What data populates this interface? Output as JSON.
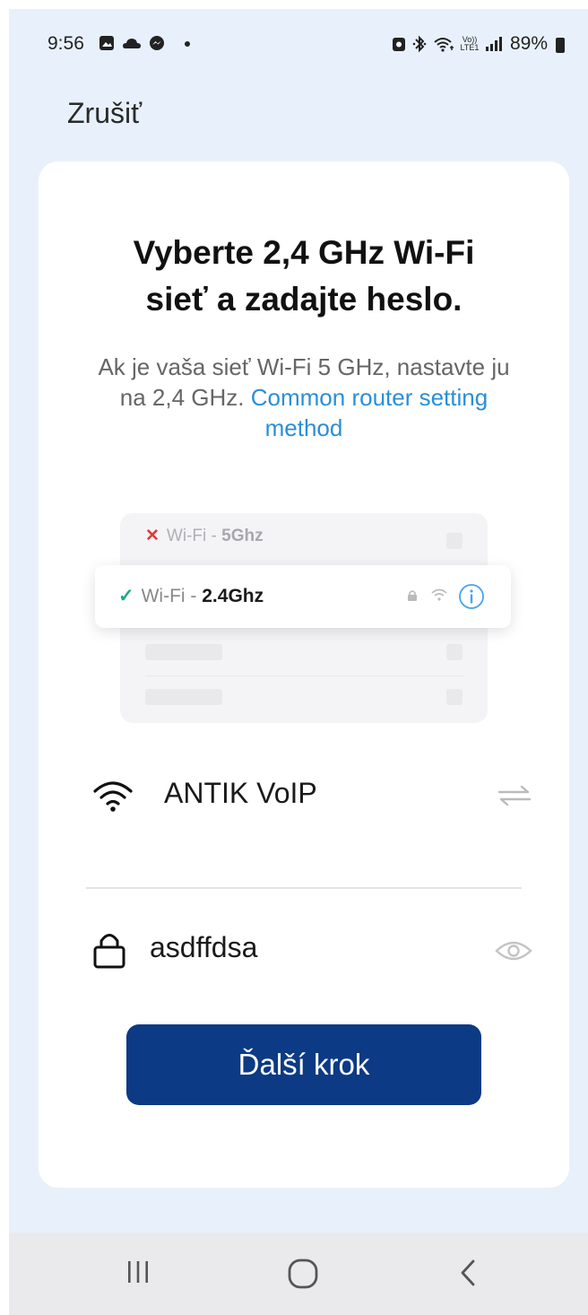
{
  "status_bar": {
    "time": "9:56",
    "right_icons": [
      "nfc-icon",
      "bluetooth-icon",
      "wifi-icon",
      "volte-icon",
      "signal-icon"
    ],
    "volte_label": "Vo))\nLTE1",
    "battery": "89%"
  },
  "header": {
    "cancel_label": "Zrušiť"
  },
  "card": {
    "title_line1": "Vyberte 2,4 GHz Wi-Fi",
    "title_line2": "sieť a zadajte heslo.",
    "subtitle": "Ak je vaša sieť Wi-Fi 5 GHz, nastavte ju na 2,4 GHz.",
    "subtitle_link": "Common router setting method",
    "illustration": {
      "row_5ghz_prefix": "Wi-Fi - ",
      "row_5ghz_band": "5Ghz",
      "row_24ghz_prefix": "Wi-Fi - ",
      "row_24ghz_band": "2.4Ghz"
    },
    "ssid_value": "ANTIK VoIP",
    "password_value": "asdffdsa",
    "next_button": "Ďalší krok"
  },
  "colors": {
    "background": "#e8f1fb",
    "primary_button": "#0c3a84",
    "link": "#2a8fd6",
    "error_x": "#e53935",
    "check": "#1aa98a"
  },
  "nav_bar": {
    "items": [
      "recent-apps-icon",
      "home-icon",
      "back-icon"
    ]
  }
}
